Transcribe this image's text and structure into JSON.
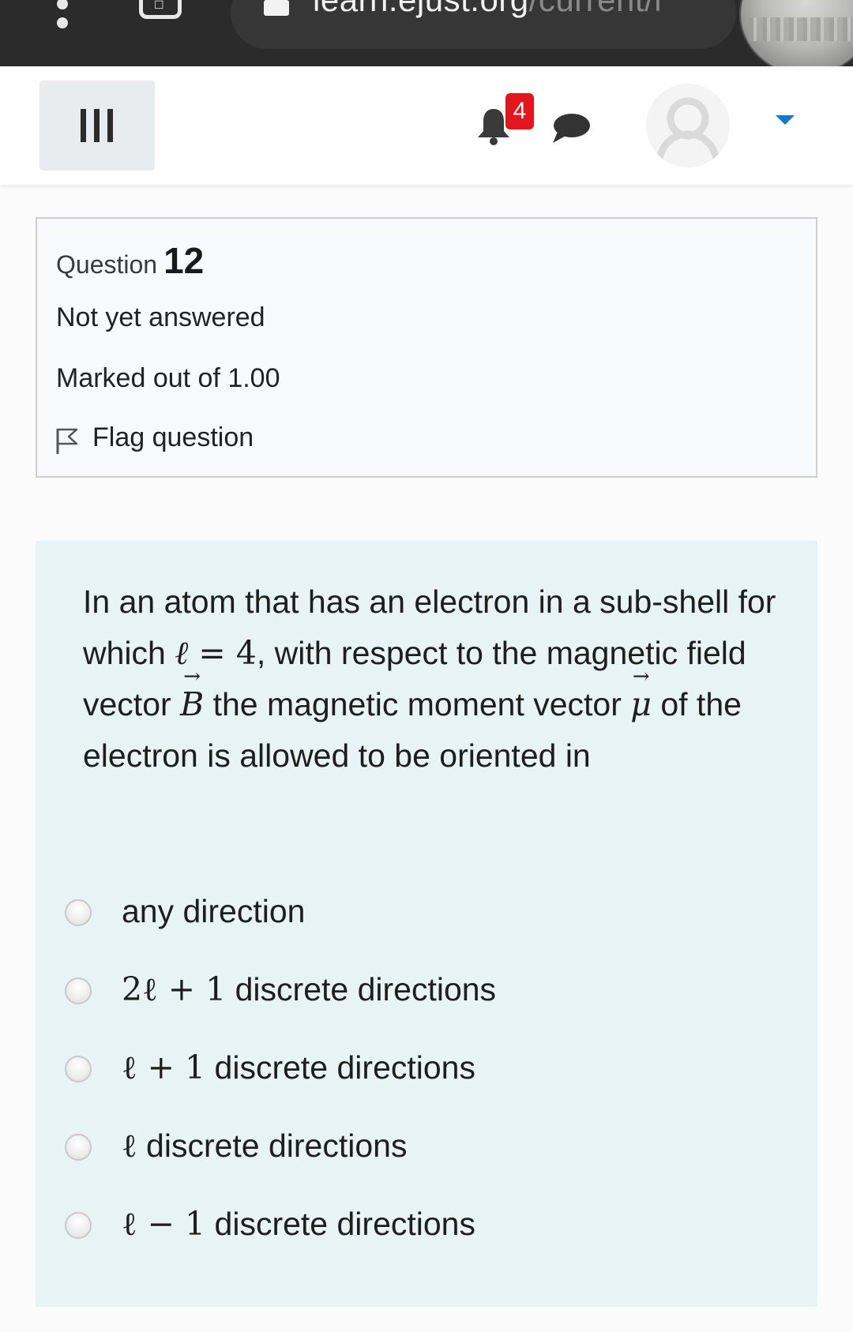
{
  "browser": {
    "url_host": "learn.ejust.org",
    "url_path": "/current/l"
  },
  "header": {
    "notification_count": "4"
  },
  "question_info": {
    "label": "Question",
    "number": "12",
    "state": "Not yet answered",
    "grade": "Marked out of 1.00",
    "flag_label": "Flag question"
  },
  "question": {
    "text_part1": "In an atom that has an electron in a sub-shell for which",
    "l_symbol": "ℓ",
    "equals": " = 4",
    "text_part2": ", with respect to the magnetic field vector",
    "B_symbol": "B",
    "text_part3": " the magnetic moment vector",
    "mu_symbol": "μ",
    "text_part4": " of the electron is allowed to be oriented in"
  },
  "answers": [
    {
      "math": "",
      "text": "any direction"
    },
    {
      "math": "2ℓ + 1",
      "text": " discrete directions"
    },
    {
      "math": "ℓ + 1",
      "text": " discrete directions"
    },
    {
      "math": "ℓ",
      "text": " discrete directions"
    },
    {
      "math": "ℓ − 1",
      "text": " discrete directions"
    }
  ],
  "colors": {
    "badge": "#e3161d",
    "caret": "#1177d1",
    "content_bg": "#e7f3f5"
  }
}
